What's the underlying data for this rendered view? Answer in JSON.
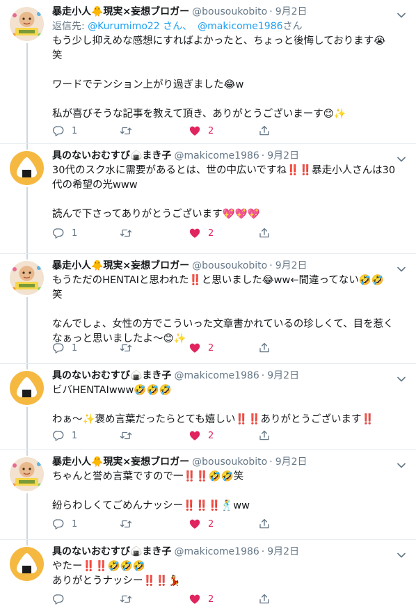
{
  "tweets": [
    {
      "avatar": "avatar-bousoukobito",
      "name": "暴走小人🐥現実×妄想ブロガー",
      "handle": "@bousoukobito",
      "separator": "·",
      "date": "9月2日",
      "reply_prefix": "返信先: ",
      "reply_mention_1": "@Kurumimo22 さん、",
      "reply_mention_2": "@makicome1986",
      "reply_suffix": "さん",
      "paragraphs": [
        "もう少し抑えめな感想にすればよかったと、ちょっと後悔しております😭\n笑",
        "ワードでテンション上がり過ぎました😂w",
        "私が喜びそうな記事を教えて頂き、ありがとうございまーす😊✨"
      ],
      "replies": "1",
      "retweets": "",
      "likes": "2"
    },
    {
      "avatar": "avatar-onigiri",
      "name": "具のないおむすび🍙まき子",
      "handle": "@makicome1986",
      "separator": "·",
      "date": "9月2日",
      "paragraphs": [
        "30代のスク水に需要があるとは、世の中広いですね‼️‼️暴走小人さんは30\n代の希望の光www",
        "読んで下さってありがとうございます💖💖💖"
      ],
      "replies": "1",
      "retweets": "",
      "likes": "2"
    },
    {
      "avatar": "avatar-bousoukobito",
      "name": "暴走小人🐥現実×妄想ブロガー",
      "handle": "@bousoukobito",
      "separator": "·",
      "date": "9月2日",
      "paragraphs": [
        "もうただのHENTAIと思われた‼️と思いました😂ww←間違ってない🤣🤣\n笑",
        "なんでしょ、女性の方でこういった文章書かれているの珍しくて、目を惹く\nなぁっと思いましたよ〜😊✨"
      ],
      "replies": "1",
      "retweets": "",
      "likes": "2"
    },
    {
      "avatar": "avatar-onigiri",
      "name": "具のないおむすび🍙まき子",
      "handle": "@makicome1986",
      "separator": "·",
      "date": "9月2日",
      "paragraphs": [
        "ビバHENTAIwww🤣🤣🤣",
        "わぁ〜✨褒め言葉だったらとても嬉しい‼️‼️ありがとうございます‼️"
      ],
      "replies": "1",
      "retweets": "",
      "likes": "2"
    },
    {
      "avatar": "avatar-bousoukobito",
      "name": "暴走小人🐥現実×妄想ブロガー",
      "handle": "@bousoukobito",
      "separator": "·",
      "date": "9月2日",
      "paragraphs": [
        "ちゃんと誉め言葉ですので一‼️‼️🤣🤣笑",
        "紛らわしくてごめんナッシー‼️‼️‼️🕺ww"
      ],
      "replies": "1",
      "retweets": "",
      "likes": "2"
    },
    {
      "avatar": "avatar-onigiri",
      "name": "具のないおむすび🍙まき子",
      "handle": "@makicome1986",
      "separator": "·",
      "date": "9月2日",
      "paragraphs": [
        "やたー‼️‼️🤣🤣🤣\nありがとうナッシー‼️‼️💃"
      ],
      "replies": "",
      "retweets": "",
      "likes": "2"
    }
  ],
  "colors": {
    "text": "#14171a",
    "muted": "#657786",
    "link": "#1da1f2",
    "like": "#e0245e",
    "divider": "#e6ecf0",
    "thread_line": "#ccd6dd",
    "onigiri_bg": "#f5b942"
  }
}
